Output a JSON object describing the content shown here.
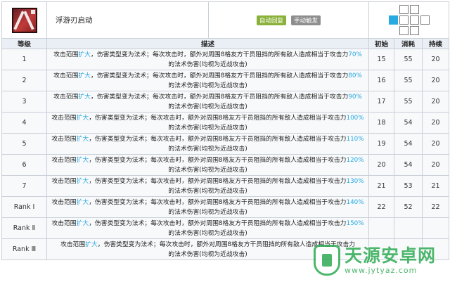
{
  "skill": {
    "name": "浮游刃启动",
    "badge_auto": "自动回复",
    "badge_manual": "手动触发",
    "icon": "skill-icon"
  },
  "range_grid": [
    [
      "e",
      "a",
      "a",
      "e"
    ],
    [
      "s",
      "a",
      "a",
      "a"
    ],
    [
      "e",
      "a",
      "a",
      "e"
    ]
  ],
  "headers": {
    "level": "等级",
    "desc": "描述",
    "init": "初始",
    "cost": "消耗",
    "duration": "持续"
  },
  "rows": [
    {
      "level": "1",
      "p1": "攻击范围",
      "h1": "扩大",
      "p2": "，伤害类型变为法术；每次攻击时，额外对周围8格友方干员阻挡的所有敌人造成相当于攻击力",
      "h2": "70%",
      "p3": "的法术伤害(均视为近战攻击)",
      "init": "15",
      "cost": "55",
      "dur": "20"
    },
    {
      "level": "2",
      "p1": "攻击范围",
      "h1": "扩大",
      "p2": "，伤害类型变为法术；每次攻击时，额外对周围8格友方干员阻挡的所有敌人造成相当于攻击力",
      "h2": "80%",
      "p3": "的法术伤害(均视为近战攻击)",
      "init": "16",
      "cost": "55",
      "dur": "20"
    },
    {
      "level": "3",
      "p1": "攻击范围",
      "h1": "扩大",
      "p2": "，伤害类型变为法术；每次攻击时，额外对周围8格友方干员阻挡的所有敌人造成相当于攻击力",
      "h2": "90%",
      "p3": "的法术伤害(均视为近战攻击)",
      "init": "17",
      "cost": "55",
      "dur": "20"
    },
    {
      "level": "4",
      "p1": "攻击范围",
      "h1": "扩大",
      "p2": "，伤害类型变为法术；每次攻击时，额外对周围8格友方干员阻挡的所有敌人造成相当于攻击力",
      "h2": "100%",
      "p3": "的法术伤害(均视为近战攻击)",
      "init": "18",
      "cost": "54",
      "dur": "20"
    },
    {
      "level": "5",
      "p1": "攻击范围",
      "h1": "扩大",
      "p2": "，伤害类型变为法术；每次攻击时，额外对周围8格友方干员阻挡的所有敌人造成相当于攻击力",
      "h2": "110%",
      "p3": "的法术伤害(均视为近战攻击)",
      "init": "19",
      "cost": "54",
      "dur": "20"
    },
    {
      "level": "6",
      "p1": "攻击范围",
      "h1": "扩大",
      "p2": "，伤害类型变为法术；每次攻击时，额外对周围8格友方干员阻挡的所有敌人造成相当于攻击力",
      "h2": "120%",
      "p3": "的法术伤害(均视为近战攻击)",
      "init": "20",
      "cost": "54",
      "dur": "20"
    },
    {
      "level": "7",
      "p1": "攻击范围",
      "h1": "扩大",
      "p2": "，伤害类型变为法术；每次攻击时，额外对周围8格友方干员阻挡的所有敌人造成相当于攻击力",
      "h2": "130%",
      "p3": "的法术伤害(均视为近战攻击)",
      "init": "21",
      "cost": "53",
      "dur": "21"
    },
    {
      "level": "Rank Ⅰ",
      "p1": "攻击范围",
      "h1": "扩大",
      "p2": "，伤害类型变为法术；每次攻击时，额外对周围8格友方干员阻挡的所有敌人造成相当于攻击力",
      "h2": "140%",
      "p3": "的法术伤害(均视为近战攻击)",
      "init": "22",
      "cost": "52",
      "dur": "22"
    },
    {
      "level": "Rank Ⅱ",
      "p1": "攻击范围",
      "h1": "扩大",
      "p2": "，伤害类型变为法术；每次攻击时，额外对周围8格友方干员阻挡的所有敌人造成相当于攻击力",
      "h2": "150%",
      "p3": "的法术伤害(均视为近战攻击)",
      "init": "",
      "cost": "",
      "dur": ""
    },
    {
      "level": "Rank Ⅲ",
      "p1": "攻击范围",
      "h1": "扩大",
      "p2": "，伤害类型变为法术；每次攻击时，额外对周围8格友方干员阻挡的所有敌人造成相当于攻击力",
      "h2": "",
      "p3": "的法术伤害(均视为近战攻击)",
      "init": "",
      "cost": "",
      "dur": ""
    }
  ],
  "watermark": {
    "cn": "天源安卓网",
    "url": "www.jytyaz.com",
    "icon": "shield-logo-icon"
  }
}
